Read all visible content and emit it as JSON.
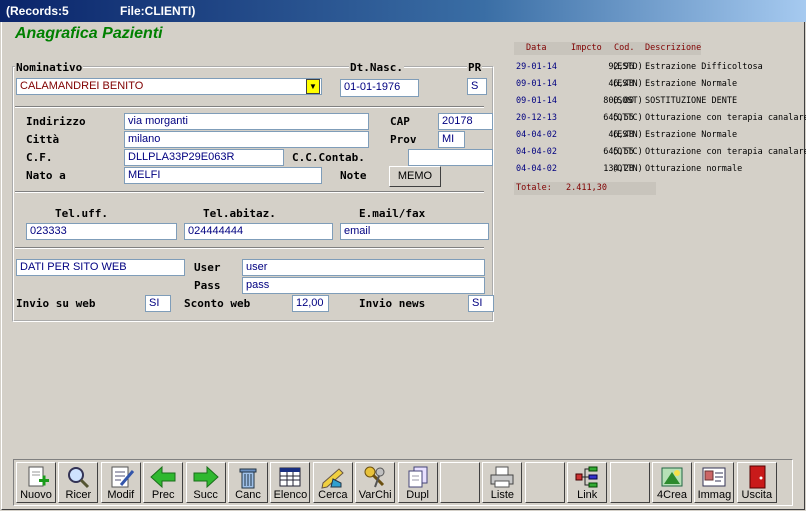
{
  "window": {
    "records": "(Records:5",
    "file": "File:CLIENTI)"
  },
  "heading": "Anagrafica Pazienti",
  "labels": {
    "nominativo": "Nominativo",
    "dt_nasc": "Dt.Nasc.",
    "pr": "PR",
    "indirizzo": "Indirizzo",
    "cap": "CAP",
    "citta": "Città",
    "prov": "Prov",
    "cf": "C.F.",
    "cc_contab": "C.C.Contab.",
    "nato_a": "Nato a",
    "note": "Note",
    "tel_uff": "Tel.uff.",
    "tel_abitaz": "Tel.abitaz.",
    "email_fax": "E.mail/fax",
    "user": "User",
    "pass": "Pass",
    "invio_web": "Invio su web",
    "sconto_web": "Sconto web",
    "invio_news": "Invio news"
  },
  "fields": {
    "nominativo": "CALAMANDREI BENITO",
    "dt_nasc": "01-01-1976",
    "pr": "S",
    "indirizzo": "via morganti",
    "cap": "20178",
    "citta": "milano",
    "prov": "MI",
    "cf": "DLLPLA33P29E063R",
    "cc_contab": "",
    "nato_a": "MELFI",
    "tel_uff": "023333",
    "tel_abitaz": "024444444",
    "email": "email",
    "sito_web": "DATI PER SITO WEB",
    "user": "user",
    "pass": "pass",
    "invio_web": "SI",
    "sconto_web": "12,00",
    "invio_news": "SI"
  },
  "buttons": {
    "memo": "MEMO"
  },
  "records": {
    "headers": {
      "date": "Data",
      "importo": "Impcto",
      "cod": "Cod.",
      "desc": "Descrizione"
    },
    "rows": [
      {
        "date": "29-01-14",
        "importo": "92,96",
        "cod": "(ESTD)",
        "desc": "Estrazione Difficoltosa"
      },
      {
        "date": "09-01-14",
        "importo": "46,48",
        "cod": "(ESTN)",
        "desc": "Estrazione Normale"
      },
      {
        "date": "09-01-14",
        "importo": "800,00",
        "cod": "(SOST)",
        "desc": "SOSTITUZIONE DENTE"
      },
      {
        "date": "20-12-13",
        "importo": "645,55",
        "cod": "(OTTC)",
        "desc": "Otturazione con terapia canalare"
      },
      {
        "date": "04-04-02",
        "importo": "46,48",
        "cod": "(ESTN)",
        "desc": "Estrazione Normale"
      },
      {
        "date": "04-04-02",
        "importo": "645,55",
        "cod": "(OTTC)",
        "desc": "Otturazione con terapia canalare"
      },
      {
        "date": "04-04-02",
        "importo": "134,28",
        "cod": "(OTTN)",
        "desc": "Otturazione normale"
      }
    ],
    "totale_label": "Totale:",
    "totale_value": "2.411,30"
  },
  "toolbar": [
    {
      "label": "Nuovo",
      "icon": "new-document-icon"
    },
    {
      "label": "Ricer",
      "icon": "magnifier-icon"
    },
    {
      "label": "Modif",
      "icon": "edit-document-icon"
    },
    {
      "label": "Prec",
      "icon": "arrow-left-icon"
    },
    {
      "label": "Succ",
      "icon": "arrow-right-icon"
    },
    {
      "label": "Canc",
      "icon": "trash-icon"
    },
    {
      "label": "Elenco",
      "icon": "table-icon"
    },
    {
      "label": "Cerca",
      "icon": "search-pencil-icon"
    },
    {
      "label": "VarChi",
      "icon": "keys-icon"
    },
    {
      "label": "Dupl",
      "icon": "duplicate-icon"
    },
    {
      "label": "",
      "icon": ""
    },
    {
      "label": "Liste",
      "icon": "printer-icon"
    },
    {
      "label": "",
      "icon": ""
    },
    {
      "label": "Link",
      "icon": "link-tree-icon"
    },
    {
      "label": "",
      "icon": ""
    },
    {
      "label": "4Crea",
      "icon": "create-icon"
    },
    {
      "label": "Immag",
      "icon": "image-card-icon"
    },
    {
      "label": "Uscita",
      "icon": "exit-door-icon"
    }
  ]
}
